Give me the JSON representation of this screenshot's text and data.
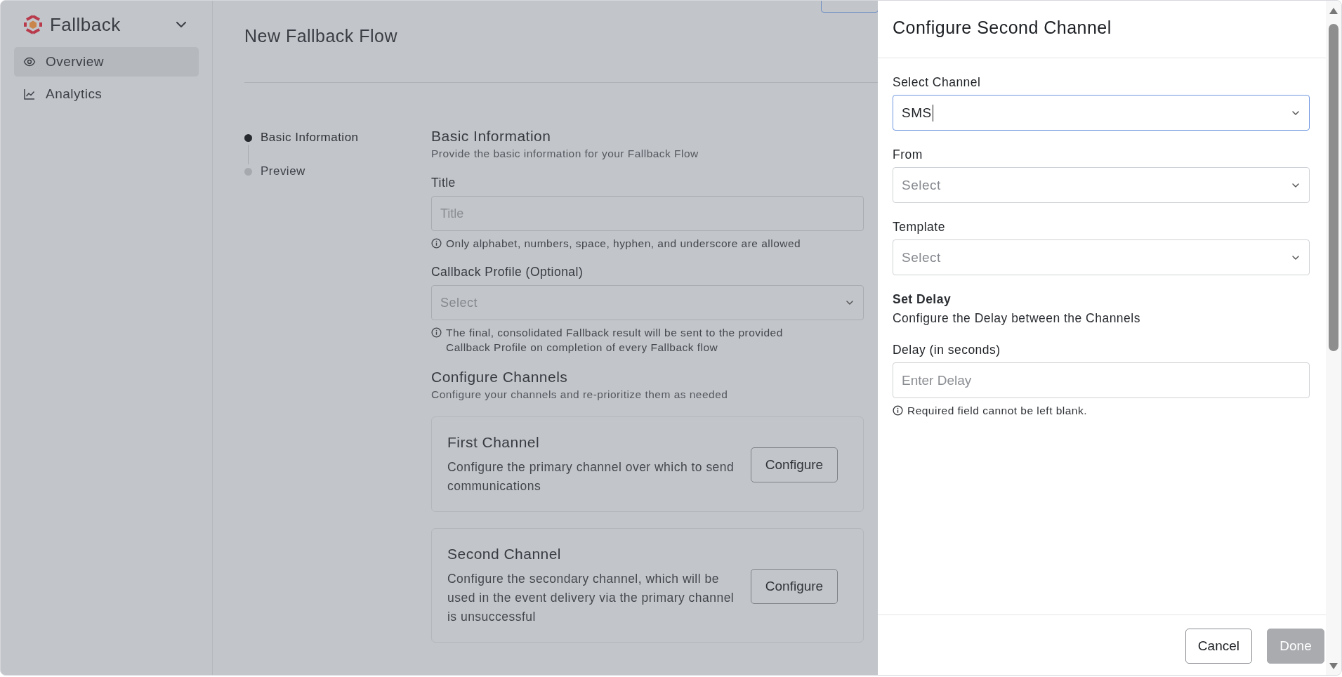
{
  "sidebar": {
    "app_name": "Fallback",
    "items": [
      {
        "label": "Overview",
        "selected": true
      },
      {
        "label": "Analytics",
        "selected": false
      }
    ]
  },
  "page": {
    "title": "New Fallback Flow"
  },
  "steps": [
    {
      "label": "Basic Information",
      "selected": true
    },
    {
      "label": "Preview",
      "selected": false
    }
  ],
  "form": {
    "heading": "Basic Information",
    "subheading": "Provide the basic information for your Fallback Flow",
    "fields": [
      {
        "kind": "text",
        "label": "Title",
        "placeholder": "Title",
        "hint": "Only alphabet, numbers, space, hyphen, and underscore are allowed"
      },
      {
        "kind": "select",
        "label": "Callback Profile (Optional)",
        "placeholder": "Select",
        "hint": "The final, consolidated Fallback result will be sent to the provided Callback Profile on completion of every Fallback flow"
      }
    ]
  },
  "channels_section": {
    "heading": "Configure Channels",
    "subheading": "Configure your channels and re-prioritize them as needed",
    "channels": [
      {
        "title": "First Channel",
        "description": "Configure the primary channel over which to send communications",
        "button": "Configure"
      },
      {
        "title": "Second Channel",
        "description": "Configure the secondary channel, which will be used in the event delivery via the primary channel is unsuccessful",
        "button": "Configure"
      }
    ]
  },
  "drawer": {
    "title": "Configure Second Channel",
    "fields": [
      {
        "kind": "select",
        "label": "Select Channel",
        "value": "SMS",
        "focused": true
      },
      {
        "kind": "select",
        "label": "From",
        "placeholder": "Select",
        "focused": false
      },
      {
        "kind": "select",
        "label": "Template",
        "placeholder": "Select",
        "focused": false
      },
      {
        "kind": "section",
        "title": "Set Delay",
        "description": "Configure the Delay between the Channels"
      },
      {
        "kind": "text",
        "label": "Delay (in seconds)",
        "placeholder": "Enter Delay",
        "hint": "Required field cannot be left blank.",
        "focused": false
      }
    ],
    "buttons": [
      {
        "label": "Cancel",
        "disabled": false
      },
      {
        "label": "Done",
        "disabled": true
      }
    ]
  }
}
